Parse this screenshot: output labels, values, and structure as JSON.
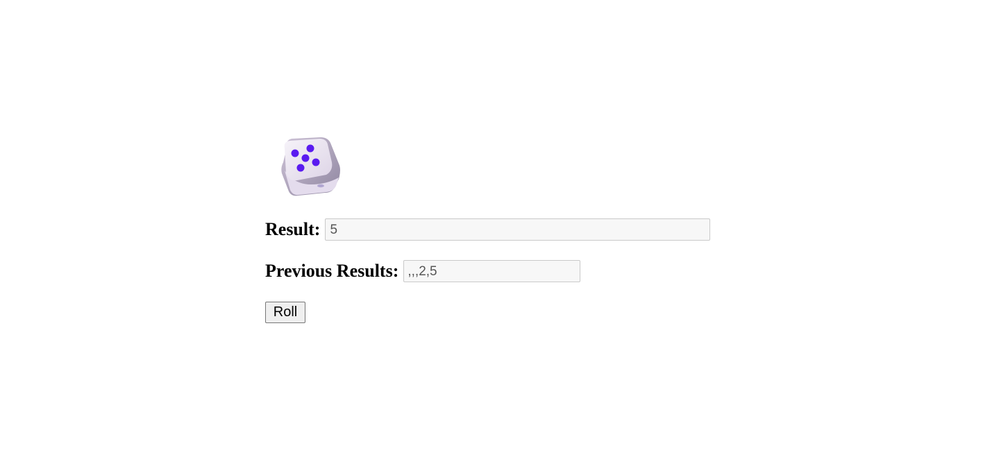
{
  "dice": {
    "icon": "dice-five-icon",
    "face_value": 5,
    "face_color": "#ece8f0",
    "pip_color": "#5a1bf0"
  },
  "result": {
    "label": "Result:",
    "value": "5"
  },
  "previous": {
    "label": "Previous Results:",
    "value": ",,,2,5"
  },
  "roll_button": {
    "label": "Roll"
  }
}
